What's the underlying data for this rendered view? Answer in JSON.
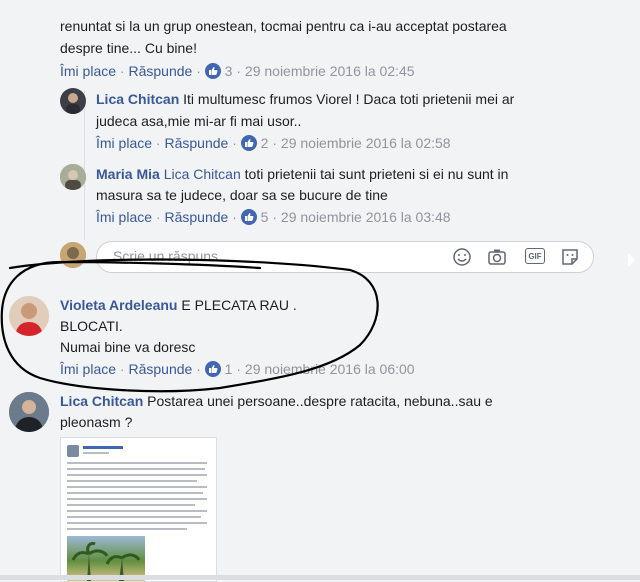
{
  "colors": {
    "background": "#f2f3f5",
    "name": "#385898",
    "meta": "#90949c",
    "like": "#4267b2",
    "annotation_ink": "#000000"
  },
  "top_comment": {
    "text_lines": [
      "renuntat si la un grup onestean, tocmai pentru ca i-au acceptat postarea",
      "despre tine... Cu bine!"
    ],
    "like_label": "Îmi place",
    "reply_label": "Răspunde",
    "like_count": "3",
    "timestamp": "29 noiembrie 2016 la 02:45"
  },
  "replies": [
    {
      "author": "Lica Chitcan",
      "avatar_icon": "user-avatar",
      "mention": "",
      "text_lines": [
        "Iti multumesc frumos Viorel ! Daca toti prietenii mei ar",
        "judeca asa,mie mi-ar fi mai usor.."
      ],
      "like_label": "Îmi place",
      "reply_label": "Răspunde",
      "like_count": "2",
      "timestamp": "29 noiembrie 2016 la 02:58"
    },
    {
      "author": "Maria Mia",
      "avatar_icon": "user-avatar",
      "mention": "Lica Chitcan",
      "text_lines": [
        "toti prietenii tai sunt prieteni si ei nu sunt in",
        "masura sa te judece, doar sa se bucure de tine"
      ],
      "like_label": "Îmi place",
      "reply_label": "Răspunde",
      "like_count": "5",
      "timestamp": "29 noiembrie 2016 la 03:48"
    }
  ],
  "reply_box": {
    "placeholder": "Scrie un răspuns...",
    "icons": [
      "emoji-icon",
      "camera-icon",
      "gif-icon",
      "sticker-icon"
    ],
    "gif_text": "GIF"
  },
  "comment_violeta": {
    "author": "Violeta Ardeleanu",
    "text_first": "E PLECATA RAU .",
    "text_lines": [
      "BLOCATI.",
      "Numai bine va doresc"
    ],
    "like_label": "Îmi place",
    "reply_label": "Răspunde",
    "like_count": "1",
    "timestamp": "29 noiembrie 2016 la 06:00"
  },
  "comment_lica": {
    "author": "Lica Chitcan",
    "text_first": "Postarea unei persoane..despre ratacita, nebuna..sau e",
    "text_lines": [
      "pleonasm ?"
    ],
    "attachment_icon": "screenshot-thumbnail"
  }
}
